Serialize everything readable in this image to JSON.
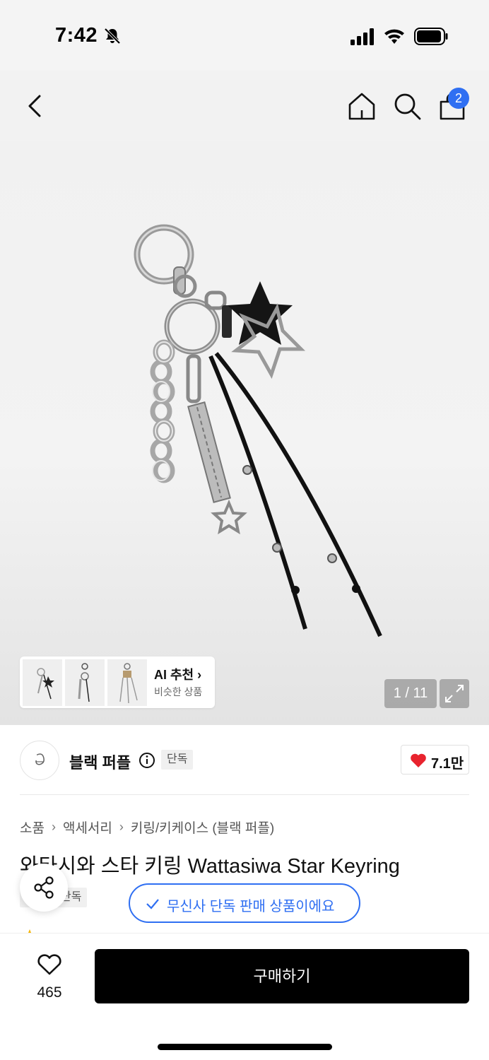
{
  "status_bar": {
    "time": "7:42"
  },
  "nav": {
    "cart_count": "2"
  },
  "gallery": {
    "ai_title": "AI 추천",
    "ai_subtitle": "비슷한 상품",
    "counter": "1 / 11"
  },
  "brand": {
    "name": "블랙 퍼플",
    "tag": "단독",
    "likes": "7.1만"
  },
  "breadcrumb": [
    "소품",
    "액세서리",
    "키링/키케이스 (블랙 퍼플)"
  ],
  "product": {
    "title": "와타시와 스타 키링 Wattasiwa Star Keyring",
    "tag": "단독",
    "exclusive_notice": "무신사 단독 판매 상품이에요"
  },
  "bottom_bar": {
    "wish_count": "465",
    "buy_label": "구매하기"
  },
  "colors": {
    "accent": "#2f6ff2",
    "like": "#e8232e"
  }
}
